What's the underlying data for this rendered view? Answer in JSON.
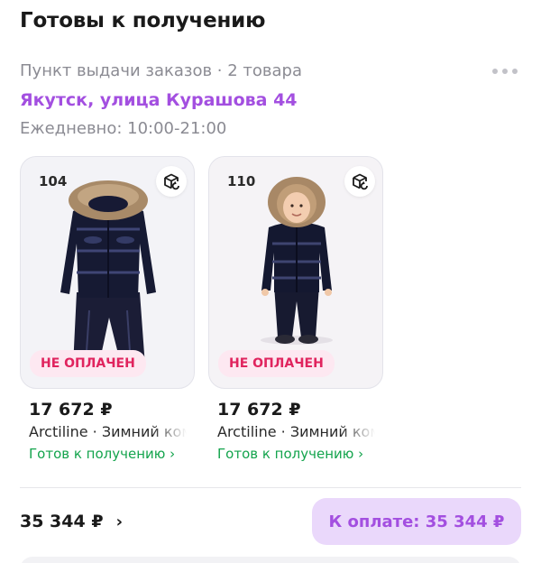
{
  "header": {
    "title": "Готовы к получению"
  },
  "pickup": {
    "subtitle": "Пункт выдачи заказов · 2 товара",
    "address": "Якутск, улица Курашова 44",
    "hours": "Ежедневно: 10:00-21:00"
  },
  "items": [
    {
      "size": "104",
      "badge": "НЕ ОПЛАЧЕН",
      "price": "17 672 ₽",
      "name": "Arctiline · Зимний комбинезон",
      "status": "Готов к получению ›"
    },
    {
      "size": "110",
      "badge": "НЕ ОПЛАЧЕН",
      "price": "17 672 ₽",
      "name": "Arctiline · Зимний комбинезон",
      "status": "Готов к получению ›"
    }
  ],
  "footer": {
    "total": "35 344 ₽",
    "total_chevron": "›",
    "pay_label": "К оплате: 35 344 ₽"
  },
  "colors": {
    "accent": "#a34fe0",
    "badge_text": "#e0245e",
    "status_green": "#14a44d"
  },
  "icons": {
    "more": "more-dots-icon",
    "reorder": "box-return-icon"
  }
}
